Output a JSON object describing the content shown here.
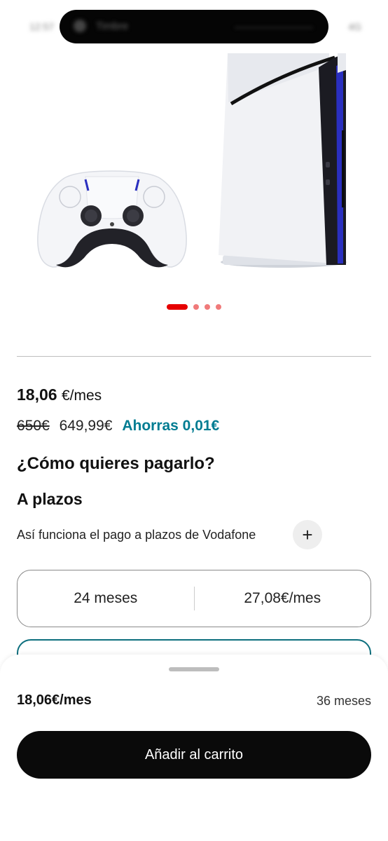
{
  "status_bar": {
    "time": "12:57",
    "notification_title": "Timbre",
    "notification_subtitle": "————————",
    "right_indicator": "4G"
  },
  "product": {
    "image_dots_total": 4,
    "image_dots_active_index": 0
  },
  "pricing": {
    "monthly_amount": "18,06",
    "monthly_unit": "€/mes",
    "old_price": "650€",
    "new_price": "649,99€",
    "savings": "Ahorras 0,01€"
  },
  "payment": {
    "heading": "¿Cómo quieres pagarlo?",
    "subheading": "A plazos",
    "info_text": "Así funciona el pago a plazos de Vodafone",
    "info_button": "+",
    "options": [
      {
        "months": "24 meses",
        "price": "27,08€/mes"
      }
    ]
  },
  "bottom_sheet": {
    "price": "18,06€/mes",
    "months": "36 meses",
    "cta": "Añadir al carrito"
  },
  "colors": {
    "brand_red": "#e60000",
    "savings_teal": "#007c92",
    "selected_border": "#0d6f7e",
    "cta_background": "#0a0a0a"
  }
}
